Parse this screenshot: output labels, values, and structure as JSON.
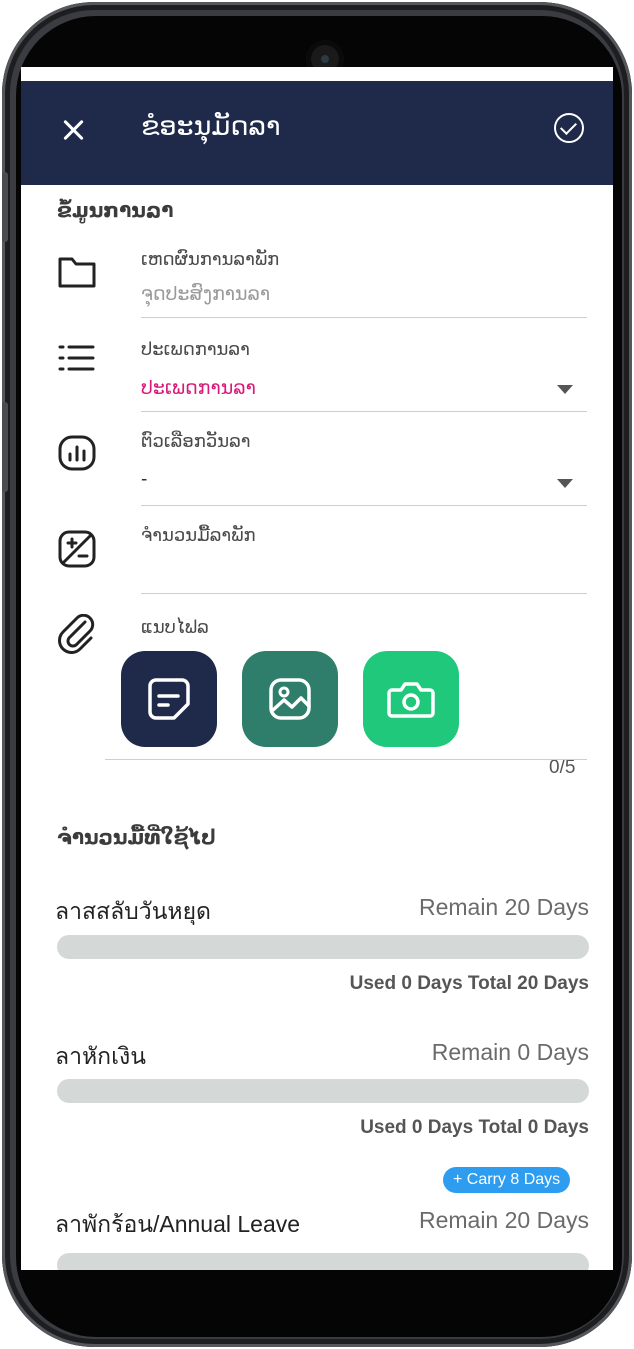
{
  "header": {
    "title": "ຂໍອະນຸມັດລາ",
    "close_icon": "close-icon",
    "confirm_icon": "check-circle-icon"
  },
  "form": {
    "section_title": "ຂໍ້ມູນການລາ",
    "reason": {
      "label": "ເຫດຜົນການລາພັກ",
      "placeholder": "ຈຸດປະສົງການລາ",
      "icon": "folder-icon"
    },
    "leave_type": {
      "label": "ປະເພດການລາ",
      "value": "ປະເພດການລາ",
      "icon": "list-icon"
    },
    "leave_option": {
      "label": "ຕົວເລືອກວັນລາ",
      "value": "-",
      "icon": "chart-icon"
    },
    "days": {
      "label": "ຈຳນວນມື້ລາພັກ",
      "value": "",
      "icon": "plus-minus-icon"
    },
    "attachment": {
      "label": "ແນບໄຟລ",
      "icon": "paperclip-icon",
      "count": "0/5",
      "buttons": [
        {
          "name": "file",
          "icon": "document-icon",
          "color": "#1f2a4a"
        },
        {
          "name": "gallery",
          "icon": "image-icon",
          "color": "#2f7e6b"
        },
        {
          "name": "camera",
          "icon": "camera-icon",
          "color": "#1fc87a"
        }
      ]
    }
  },
  "usage": {
    "section_title": "ຈຳນວນມື້ທີ່ໃຊ້ໄປ",
    "items": [
      {
        "name": "ลาสสลับวันหยุด",
        "remain": "Remain 20 Days",
        "used_text": "Used 0 Days Total 20 Days",
        "used_fraction": 0
      },
      {
        "name": "ลาหักเงิน",
        "remain": "Remain 0 Days",
        "used_text": "Used 0 Days Total 0 Days",
        "used_fraction": 0
      },
      {
        "name": "ลาพักร้อน/Annual Leave",
        "remain": "Remain 20 Days",
        "carry": "+ Carry 8 Days",
        "used_fraction": 0
      }
    ]
  },
  "colors": {
    "header_bg": "#1f2a4a",
    "accent_pink": "#d81b7a",
    "carry_badge": "#2e9df0"
  }
}
